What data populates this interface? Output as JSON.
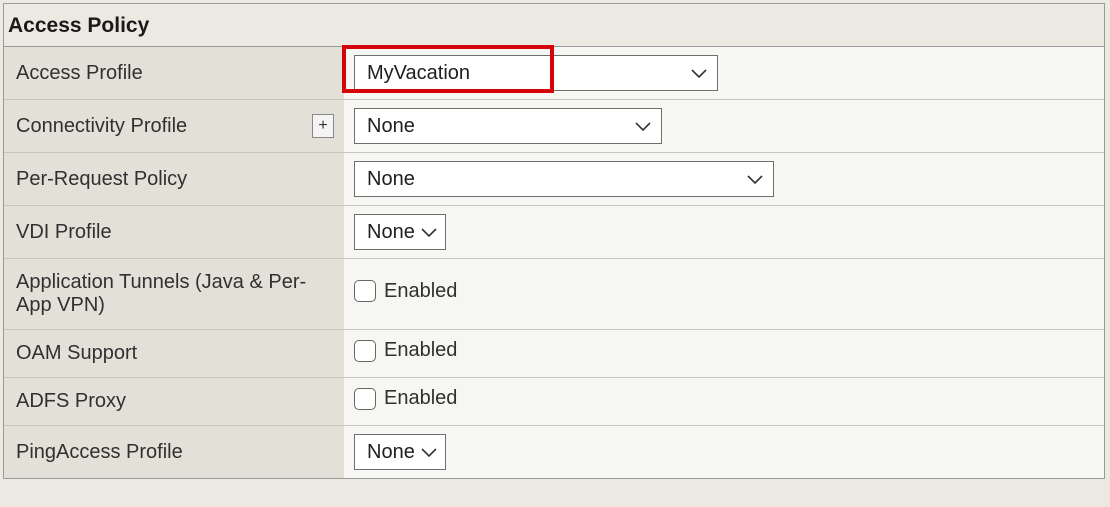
{
  "panel": {
    "title": "Access Policy"
  },
  "rows": {
    "access_profile": {
      "label": "Access Profile",
      "value": "MyVacation"
    },
    "connectivity_profile": {
      "label": "Connectivity Profile",
      "value": "None",
      "add_label": "+"
    },
    "per_request_policy": {
      "label": "Per-Request Policy",
      "value": "None"
    },
    "vdi_profile": {
      "label": "VDI Profile",
      "value": "None"
    },
    "app_tunnels": {
      "label": "Application Tunnels (Java & Per-App VPN)",
      "checkbox_label": "Enabled"
    },
    "oam_support": {
      "label": "OAM Support",
      "checkbox_label": "Enabled"
    },
    "adfs_proxy": {
      "label": "ADFS Proxy",
      "checkbox_label": "Enabled"
    },
    "pingaccess_profile": {
      "label": "PingAccess Profile",
      "value": "None"
    }
  }
}
